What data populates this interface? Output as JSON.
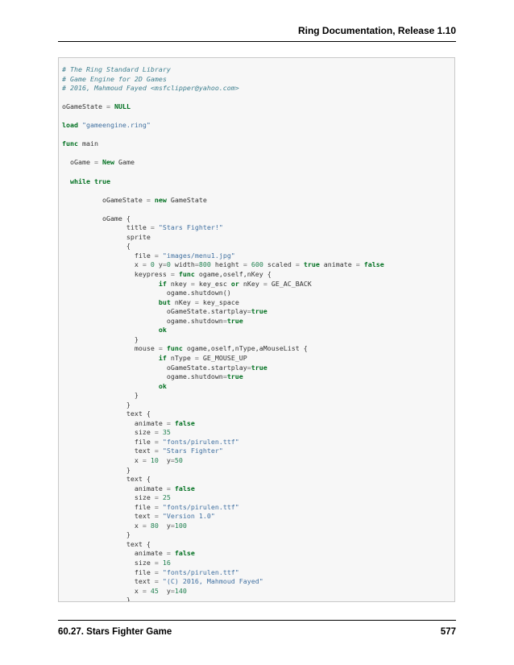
{
  "header": {
    "title": "Ring Documentation, Release 1.10"
  },
  "footer": {
    "section": "60.27.  Stars Fighter Game",
    "page_number": "577"
  },
  "colors": {
    "comment": "#408090",
    "keyword": "#007020",
    "string": "#4070a0",
    "number": "#208050",
    "operator": "#666666",
    "code_background": "#f7f7f7"
  },
  "code": {
    "lines": [
      [
        [
          "c",
          "# The Ring Standard Library"
        ]
      ],
      [
        [
          "c",
          "# Game Engine for 2D Games"
        ]
      ],
      [
        [
          "c",
          "# 2016, Mahmoud Fayed <msfclipper@yahoo.com>"
        ]
      ],
      [],
      [
        [
          "t",
          "oGameState "
        ],
        [
          "o",
          "="
        ],
        [
          "t",
          " "
        ],
        [
          "k",
          "NULL"
        ]
      ],
      [],
      [
        [
          "k",
          "load"
        ],
        [
          "t",
          " "
        ],
        [
          "s",
          "\"gameengine.ring\""
        ]
      ],
      [],
      [
        [
          "k",
          "func"
        ],
        [
          "t",
          " main"
        ]
      ],
      [],
      [
        [
          "t",
          "  oGame "
        ],
        [
          "o",
          "="
        ],
        [
          "t",
          " "
        ],
        [
          "k",
          "New"
        ],
        [
          "t",
          " Game"
        ]
      ],
      [],
      [
        [
          "t",
          "  "
        ],
        [
          "k",
          "while"
        ],
        [
          "t",
          " "
        ],
        [
          "k",
          "true"
        ]
      ],
      [],
      [
        [
          "t",
          "          oGameState "
        ],
        [
          "o",
          "="
        ],
        [
          "t",
          " "
        ],
        [
          "k",
          "new"
        ],
        [
          "t",
          " GameState"
        ]
      ],
      [],
      [
        [
          "t",
          "          oGame {"
        ]
      ],
      [
        [
          "t",
          "                title "
        ],
        [
          "o",
          "="
        ],
        [
          "t",
          " "
        ],
        [
          "s",
          "\"Stars Fighter!\""
        ]
      ],
      [
        [
          "t",
          "                sprite"
        ]
      ],
      [
        [
          "t",
          "                {"
        ]
      ],
      [
        [
          "t",
          "                  file "
        ],
        [
          "o",
          "="
        ],
        [
          "t",
          " "
        ],
        [
          "s",
          "\"images/menu1.jpg\""
        ]
      ],
      [
        [
          "t",
          "                  x "
        ],
        [
          "o",
          "="
        ],
        [
          "t",
          " "
        ],
        [
          "n",
          "0"
        ],
        [
          "t",
          " y"
        ],
        [
          "o",
          "="
        ],
        [
          "n",
          "0"
        ],
        [
          "t",
          " width"
        ],
        [
          "o",
          "="
        ],
        [
          "n",
          "800"
        ],
        [
          "t",
          " height "
        ],
        [
          "o",
          "="
        ],
        [
          "t",
          " "
        ],
        [
          "n",
          "600"
        ],
        [
          "t",
          " scaled "
        ],
        [
          "o",
          "="
        ],
        [
          "t",
          " "
        ],
        [
          "k",
          "true"
        ],
        [
          "t",
          " animate "
        ],
        [
          "o",
          "="
        ],
        [
          "t",
          " "
        ],
        [
          "k",
          "false"
        ]
      ],
      [
        [
          "t",
          "                  keypress "
        ],
        [
          "o",
          "="
        ],
        [
          "t",
          " "
        ],
        [
          "k",
          "func"
        ],
        [
          "t",
          " ogame,oself,nKey {"
        ]
      ],
      [
        [
          "t",
          "                        "
        ],
        [
          "k",
          "if"
        ],
        [
          "t",
          " nkey "
        ],
        [
          "o",
          "="
        ],
        [
          "t",
          " key_esc "
        ],
        [
          "k",
          "or"
        ],
        [
          "t",
          " nKey "
        ],
        [
          "o",
          "="
        ],
        [
          "t",
          " GE_AC_BACK"
        ]
      ],
      [
        [
          "t",
          "                          ogame.shutdown()"
        ]
      ],
      [
        [
          "t",
          "                        "
        ],
        [
          "k",
          "but"
        ],
        [
          "t",
          " nKey "
        ],
        [
          "o",
          "="
        ],
        [
          "t",
          " key_space"
        ]
      ],
      [
        [
          "t",
          "                          oGameState.startplay"
        ],
        [
          "o",
          "="
        ],
        [
          "k",
          "true"
        ]
      ],
      [
        [
          "t",
          "                          ogame.shutdown"
        ],
        [
          "o",
          "="
        ],
        [
          "k",
          "true"
        ]
      ],
      [
        [
          "t",
          "                        "
        ],
        [
          "k",
          "ok"
        ]
      ],
      [
        [
          "t",
          "                  }"
        ]
      ],
      [
        [
          "t",
          "                  mouse "
        ],
        [
          "o",
          "="
        ],
        [
          "t",
          " "
        ],
        [
          "k",
          "func"
        ],
        [
          "t",
          " ogame,oself,nType,aMouseList {"
        ]
      ],
      [
        [
          "t",
          "                        "
        ],
        [
          "k",
          "if"
        ],
        [
          "t",
          " nType "
        ],
        [
          "o",
          "="
        ],
        [
          "t",
          " GE_MOUSE_UP"
        ]
      ],
      [
        [
          "t",
          "                          oGameState.startplay"
        ],
        [
          "o",
          "="
        ],
        [
          "k",
          "true"
        ]
      ],
      [
        [
          "t",
          "                          ogame.shutdown"
        ],
        [
          "o",
          "="
        ],
        [
          "k",
          "true"
        ]
      ],
      [
        [
          "t",
          "                        "
        ],
        [
          "k",
          "ok"
        ]
      ],
      [
        [
          "t",
          "                  }"
        ]
      ],
      [
        [
          "t",
          "                }"
        ]
      ],
      [
        [
          "t",
          "                text {"
        ]
      ],
      [
        [
          "t",
          "                  animate "
        ],
        [
          "o",
          "="
        ],
        [
          "t",
          " "
        ],
        [
          "k",
          "false"
        ]
      ],
      [
        [
          "t",
          "                  size "
        ],
        [
          "o",
          "="
        ],
        [
          "t",
          " "
        ],
        [
          "n",
          "35"
        ]
      ],
      [
        [
          "t",
          "                  file "
        ],
        [
          "o",
          "="
        ],
        [
          "t",
          " "
        ],
        [
          "s",
          "\"fonts/pirulen.ttf\""
        ]
      ],
      [
        [
          "t",
          "                  text "
        ],
        [
          "o",
          "="
        ],
        [
          "t",
          " "
        ],
        [
          "s",
          "\"Stars Fighter\""
        ]
      ],
      [
        [
          "t",
          "                  x "
        ],
        [
          "o",
          "="
        ],
        [
          "t",
          " "
        ],
        [
          "n",
          "10"
        ],
        [
          "t",
          "  y"
        ],
        [
          "o",
          "="
        ],
        [
          "n",
          "50"
        ]
      ],
      [
        [
          "t",
          "                }"
        ]
      ],
      [
        [
          "t",
          "                text {"
        ]
      ],
      [
        [
          "t",
          "                  animate "
        ],
        [
          "o",
          "="
        ],
        [
          "t",
          " "
        ],
        [
          "k",
          "false"
        ]
      ],
      [
        [
          "t",
          "                  size "
        ],
        [
          "o",
          "="
        ],
        [
          "t",
          " "
        ],
        [
          "n",
          "25"
        ]
      ],
      [
        [
          "t",
          "                  file "
        ],
        [
          "o",
          "="
        ],
        [
          "t",
          " "
        ],
        [
          "s",
          "\"fonts/pirulen.ttf\""
        ]
      ],
      [
        [
          "t",
          "                  text "
        ],
        [
          "o",
          "="
        ],
        [
          "t",
          " "
        ],
        [
          "s",
          "\"Version 1.0\""
        ]
      ],
      [
        [
          "t",
          "                  x "
        ],
        [
          "o",
          "="
        ],
        [
          "t",
          " "
        ],
        [
          "n",
          "80"
        ],
        [
          "t",
          "  y"
        ],
        [
          "o",
          "="
        ],
        [
          "n",
          "100"
        ]
      ],
      [
        [
          "t",
          "                }"
        ]
      ],
      [
        [
          "t",
          "                text {"
        ]
      ],
      [
        [
          "t",
          "                  animate "
        ],
        [
          "o",
          "="
        ],
        [
          "t",
          " "
        ],
        [
          "k",
          "false"
        ]
      ],
      [
        [
          "t",
          "                  size "
        ],
        [
          "o",
          "="
        ],
        [
          "t",
          " "
        ],
        [
          "n",
          "16"
        ]
      ],
      [
        [
          "t",
          "                  file "
        ],
        [
          "o",
          "="
        ],
        [
          "t",
          " "
        ],
        [
          "s",
          "\"fonts/pirulen.ttf\""
        ]
      ],
      [
        [
          "t",
          "                  text "
        ],
        [
          "o",
          "="
        ],
        [
          "t",
          " "
        ],
        [
          "s",
          "\"(C) 2016, Mahmoud Fayed\""
        ]
      ],
      [
        [
          "t",
          "                  x "
        ],
        [
          "o",
          "="
        ],
        [
          "t",
          " "
        ],
        [
          "n",
          "45"
        ],
        [
          "t",
          "  y"
        ],
        [
          "o",
          "="
        ],
        [
          "n",
          "140"
        ]
      ],
      [
        [
          "t",
          "                }"
        ]
      ]
    ]
  }
}
